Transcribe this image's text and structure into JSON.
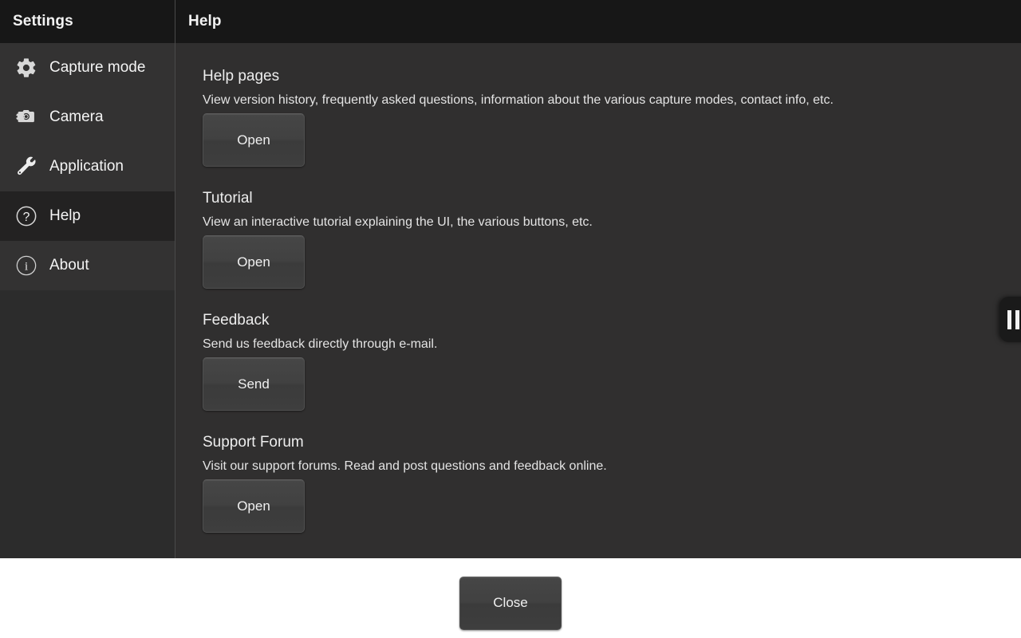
{
  "sidebar": {
    "header": "Settings",
    "items": [
      {
        "label": "Capture mode",
        "icon": "gear-icon",
        "active": false
      },
      {
        "label": "Camera",
        "icon": "camera-gear-icon",
        "active": false
      },
      {
        "label": "Application",
        "icon": "wrench-icon",
        "active": false
      },
      {
        "label": "Help",
        "icon": "question-circle-icon",
        "active": true
      },
      {
        "label": "About",
        "icon": "info-circle-icon",
        "active": false
      }
    ]
  },
  "content": {
    "header": "Help",
    "sections": [
      {
        "title": "Help pages",
        "description": "View version history, frequently asked questions, information about the various capture modes, contact info, etc.",
        "button": "Open"
      },
      {
        "title": "Tutorial",
        "description": "View an interactive tutorial explaining the UI, the various buttons, etc.",
        "button": "Open"
      },
      {
        "title": "Feedback",
        "description": "Send us feedback directly through e-mail.",
        "button": "Send"
      },
      {
        "title": "Support Forum",
        "description": "Visit our support forums. Read and post questions and feedback online.",
        "button": "Open"
      }
    ]
  },
  "footer": {
    "close_label": "Close"
  },
  "overlay": {
    "pause_widget": {
      "icon": "pause-icon"
    }
  },
  "colors": {
    "header_bar": "#171717",
    "sidebar_bg": "#333232",
    "sidebar_active": "#232222",
    "content_bg": "#302f2f",
    "text_primary": "#f2f2f2",
    "divider": "#4a4a4a",
    "footer_bg": "#ffffff"
  }
}
